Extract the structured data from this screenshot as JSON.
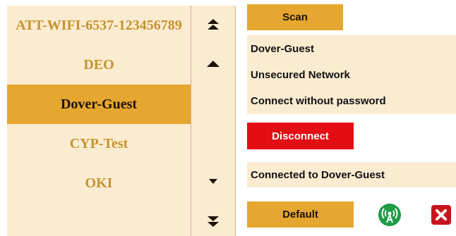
{
  "networks": [
    {
      "name": "ATT-WIFI-6537-123456789",
      "selected": false
    },
    {
      "name": "DEO",
      "selected": false
    },
    {
      "name": "Dover-Guest",
      "selected": true
    },
    {
      "name": "CYP-Test",
      "selected": false
    },
    {
      "name": "OKI",
      "selected": false
    }
  ],
  "scroll_icons": [
    "double-chevron-up-icon",
    "chevron-up-icon",
    "chevron-down-icon",
    "double-chevron-down-icon"
  ],
  "scan_label": "Scan",
  "info": {
    "ssid": "Dover-Guest",
    "security": "Unsecured Network",
    "connect_hint": "Connect without password"
  },
  "disconnect_label": "Disconnect",
  "status_text": "Connected to Dover-Guest",
  "default_label": "Default",
  "icons": {
    "wifi": "wifi-antenna-icon",
    "close": "close-icon"
  },
  "colors": {
    "accent": "#e5a72f",
    "panel": "#fbebd0",
    "item_text": "#c4932f",
    "danger": "#e40d14",
    "wifi_green": "#1f9a47",
    "close_red": "#c8141c"
  }
}
